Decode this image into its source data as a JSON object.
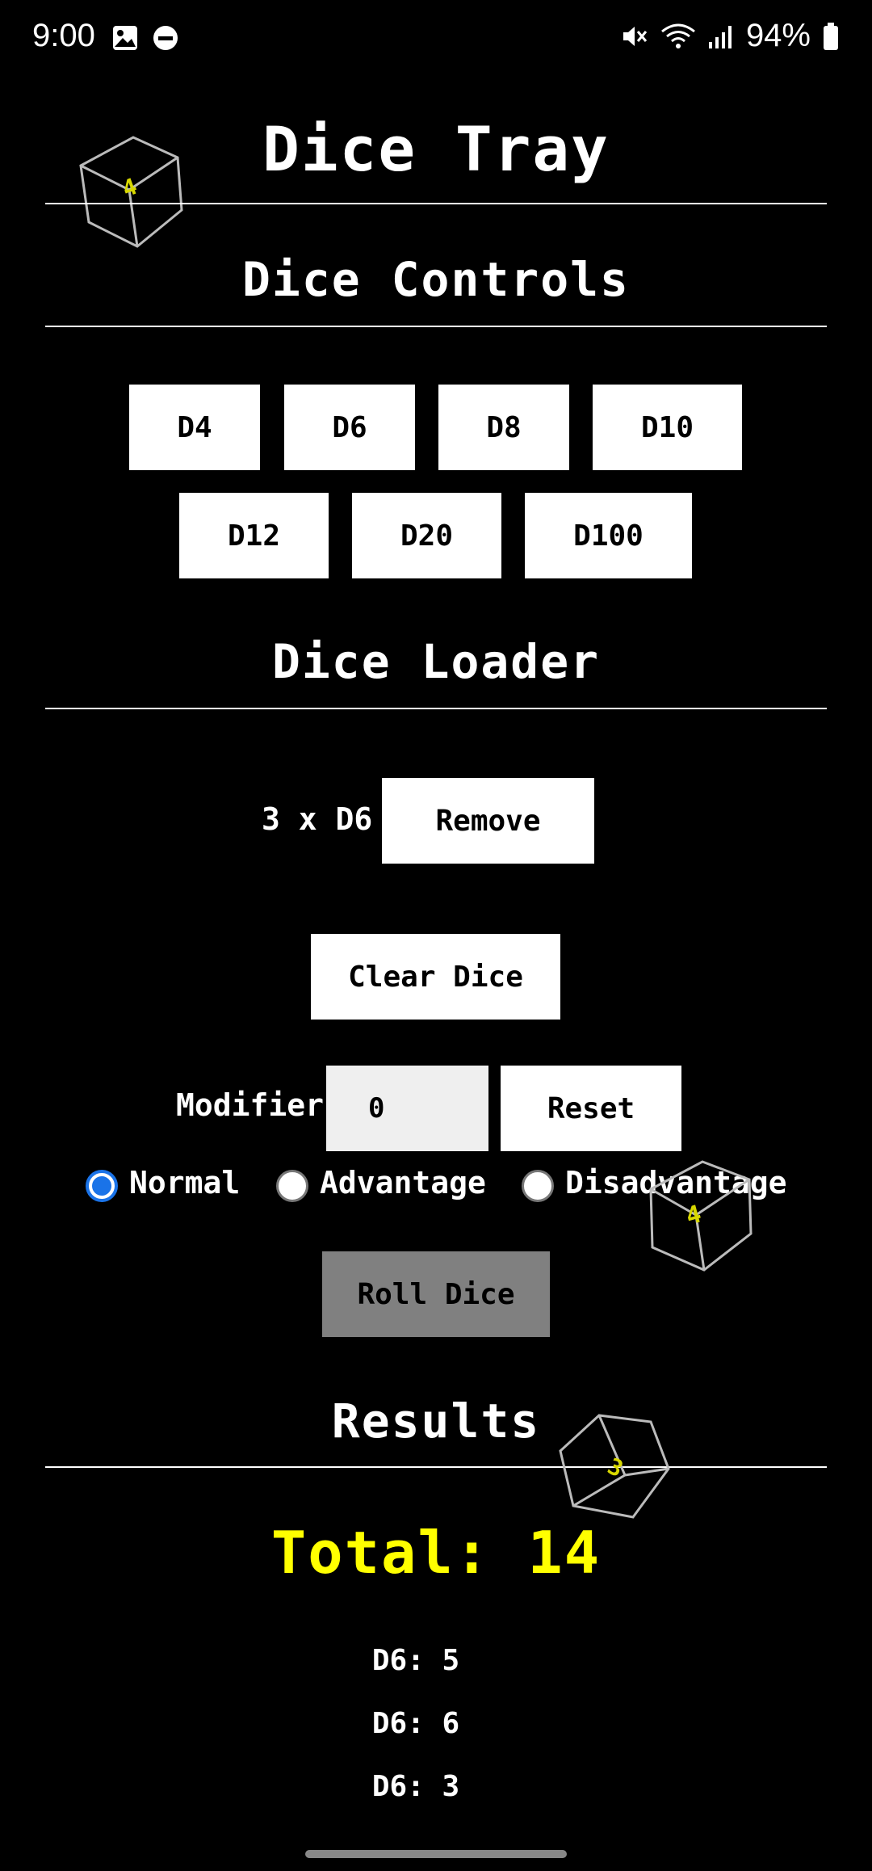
{
  "status_bar": {
    "time": "9:00",
    "battery": "94%",
    "icons": [
      "image-icon",
      "dnd-icon",
      "mute-icon",
      "wifi-icon",
      "signal-icon",
      "battery-icon"
    ]
  },
  "app": {
    "title": "Dice Tray"
  },
  "dice_controls": {
    "heading": "Dice Controls",
    "buttons": [
      "D4",
      "D6",
      "D8",
      "D10",
      "D12",
      "D20",
      "D100"
    ]
  },
  "dice_loader": {
    "heading": "Dice Loader",
    "loaded_item": "3 x D6",
    "remove_label": "Remove",
    "clear_label": "Clear Dice",
    "modifier_label": "Modifier:",
    "modifier_value": "0",
    "reset_label": "Reset",
    "roll_modes": [
      {
        "label": "Normal",
        "selected": true
      },
      {
        "label": "Advantage",
        "selected": false
      },
      {
        "label": "Disadvantage",
        "selected": false
      }
    ],
    "roll_label": "Roll Dice"
  },
  "results": {
    "heading": "Results",
    "total": "Total: 14",
    "rolls": [
      "D6: 5",
      "D6: 6",
      "D6: 3"
    ]
  },
  "decor": {
    "cube_face_values": [
      "4",
      "4",
      "3"
    ],
    "cube_number_color": "#d8d800",
    "cube_edge_color": "#bbbbbb"
  },
  "colors": {
    "background": "#000000",
    "accent_total": "#ffff00",
    "radio_selected": "#1a73e8",
    "roll_disabled": "#808080"
  }
}
